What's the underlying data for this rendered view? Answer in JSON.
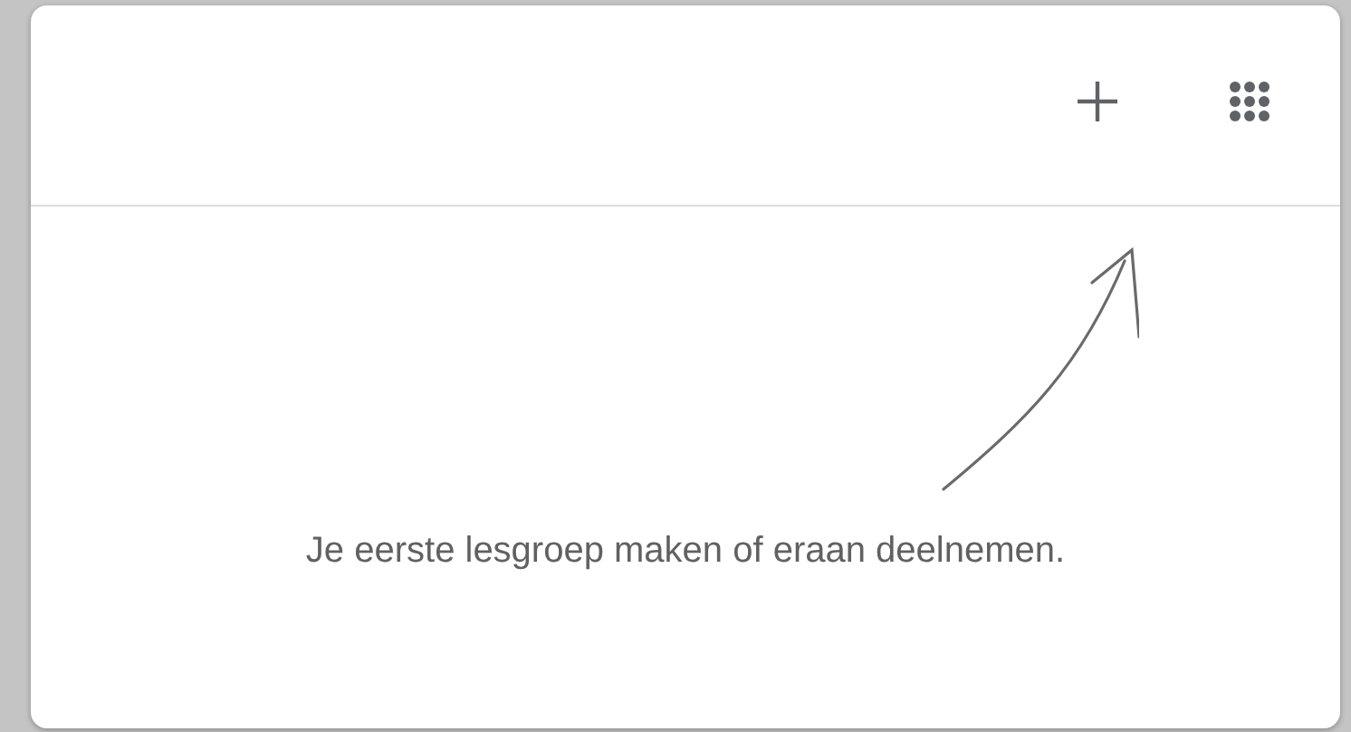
{
  "header": {
    "actions": [
      {
        "kind": "add"
      },
      {
        "kind": "apps"
      }
    ]
  },
  "empty_state": {
    "message": "Je eerste lesgroep maken of eraan deelnemen."
  }
}
